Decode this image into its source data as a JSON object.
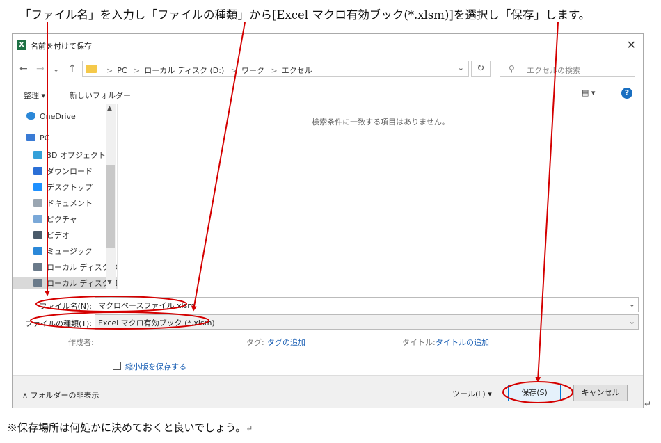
{
  "instruction": "「ファイル名」を入力し「ファイルの種類」から[Excel マクロ有効ブック(*.xlsm)]を選択し「保存」します。",
  "note": "※保存場所は何処かに決めておくと良いでしょう。",
  "return_mark": "↵",
  "dialog": {
    "app_icon": "X",
    "title": "名前を付けて保存",
    "close": "✕",
    "nav": {
      "back": "←",
      "forward": "→",
      "recent": "⌄",
      "up": "↑"
    },
    "breadcrumbs": [
      "PC",
      "ローカル ディスク (D:)",
      "ワーク",
      "エクセル"
    ],
    "breadcrumb_sep": ">",
    "refresh": "↻",
    "search_icon": "⚲",
    "search_placeholder": "エクセルの検索",
    "toolbar": {
      "organize": "整理 ▾",
      "new_folder": "新しいフォルダー",
      "help": "?"
    },
    "nav_items": [
      {
        "label": "OneDrive",
        "icon": "cloud-icon",
        "color": "#2b88d8"
      },
      {
        "label": "PC",
        "icon": "computer-icon",
        "color": "#3a7bd5"
      },
      {
        "label": "3D オブジェクト",
        "icon": "cube-icon",
        "color": "#34a0d9"
      },
      {
        "label": "ダウンロード",
        "icon": "download-icon",
        "color": "#2b6fd6"
      },
      {
        "label": "デスクトップ",
        "icon": "desktop-icon",
        "color": "#1e90ff"
      },
      {
        "label": "ドキュメント",
        "icon": "document-icon",
        "color": "#9aa6b2"
      },
      {
        "label": "ピクチャ",
        "icon": "pictures-icon",
        "color": "#7aa8d8"
      },
      {
        "label": "ビデオ",
        "icon": "video-icon",
        "color": "#4a5a6a"
      },
      {
        "label": "ミュージック",
        "icon": "music-icon",
        "color": "#2b88d8"
      },
      {
        "label": "ローカル ディスク (C",
        "icon": "drive-icon",
        "color": "#6a7a8a"
      },
      {
        "label": "ローカル ディスク (D",
        "icon": "drive-icon",
        "color": "#6a7a8a"
      }
    ],
    "empty_message": "検索条件に一致する項目はありません。",
    "filename_label": "ファイル名(N):",
    "filename_value": "マクロベースファイル.xlsm",
    "filetype_label": "ファイルの種類(T):",
    "filetype_value": "Excel マクロ有効ブック (*.xlsm)",
    "author_label": "作成者:",
    "tags_label": "タグ:",
    "tags_link": "タグの追加",
    "title_label": "タイトル:",
    "title_link": "タイトルの追加",
    "thumbnail_label": "縮小版を保存する",
    "hide_folders": "フォルダーの非表示",
    "tools": "ツール(L)  ▾",
    "save": "保存(S)",
    "cancel": "キャンセル"
  },
  "colors": {
    "annotation": "#d40000",
    "accent": "#0078d7"
  }
}
